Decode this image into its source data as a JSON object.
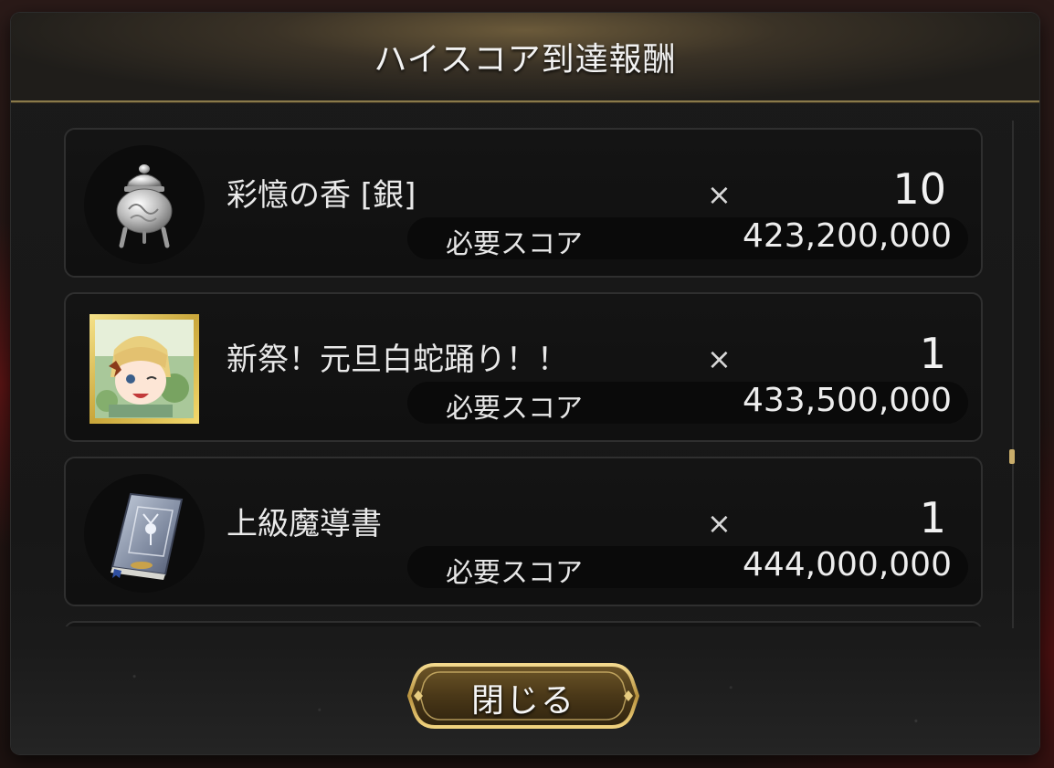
{
  "dialog": {
    "title": "ハイスコア到達報酬"
  },
  "rewards": [
    {
      "name": "彩憶の香 [銀]",
      "times": "×",
      "quantity": "10",
      "score_label": "必要スコア",
      "score_value": "423,200,000",
      "icon": "silver-incense-burner-icon"
    },
    {
      "name": "新祭！元旦白蛇踊り！！",
      "times": "×",
      "quantity": "1",
      "score_label": "必要スコア",
      "score_value": "433,500,000",
      "icon": "character-card-icon"
    },
    {
      "name": "上級魔導書",
      "times": "×",
      "quantity": "1",
      "score_label": "必要スコア",
      "score_value": "444,000,000",
      "icon": "spellbook-icon"
    }
  ],
  "close_button": {
    "label": "閉じる"
  },
  "colors": {
    "accent_gold": "#c9ad6a",
    "panel_bg": "#171717"
  }
}
